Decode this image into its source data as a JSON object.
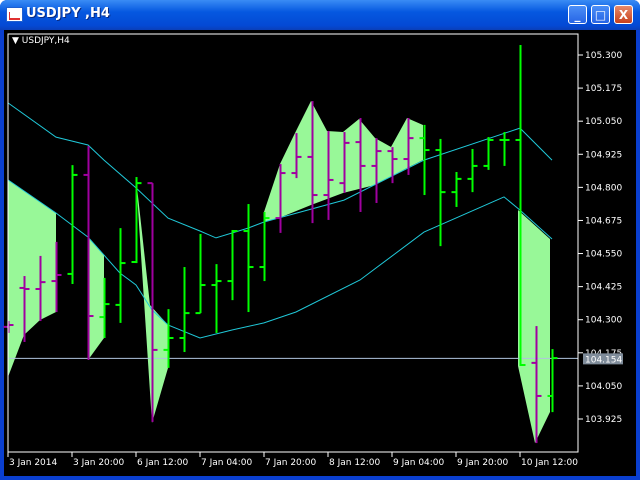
{
  "window": {
    "title": "USDJPY ,H4",
    "minimize": "_",
    "maximize": "□",
    "close": "X"
  },
  "chart_title": {
    "arrow": "▼",
    "label": "USDJPY,H4"
  },
  "colors": {
    "up": "#00ff00",
    "down": "#a000a0",
    "fill": "#98f898",
    "band": "#20c8d8",
    "price_line": "#b0c4de",
    "price_box": "#7f8c9a"
  },
  "chart_data": {
    "type": "ohlc",
    "symbol": "USDJPY",
    "timeframe": "H4",
    "ylim": [
      103.85,
      105.35
    ],
    "y_ticks": [
      "105.300",
      "105.175",
      "105.050",
      "104.925",
      "104.800",
      "104.675",
      "104.550",
      "104.425",
      "104.300",
      "104.175",
      "104.050",
      "103.925"
    ],
    "x_ticks": [
      "3 Jan 2014",
      "3 Jan 20:00",
      "6 Jan 12:00",
      "7 Jan 04:00",
      "7 Jan 20:00",
      "8 Jan 12:00",
      "9 Jan 04:00",
      "9 Jan 20:00",
      "10 Jan 12:00"
    ],
    "current_price": "104.154",
    "bars": [
      {
        "o": 104.273,
        "h": 104.295,
        "l": 104.25,
        "c": 104.28,
        "col": "down"
      },
      {
        "o": 104.42,
        "h": 104.465,
        "l": 104.216,
        "c": 104.416,
        "col": "down"
      },
      {
        "o": 104.416,
        "h": 104.541,
        "l": 104.295,
        "c": 104.442,
        "col": "down"
      },
      {
        "o": 104.446,
        "h": 104.594,
        "l": 104.329,
        "c": 104.469,
        "col": "down"
      },
      {
        "o": 104.473,
        "h": 104.884,
        "l": 104.435,
        "c": 104.847,
        "col": "up"
      },
      {
        "o": 104.847,
        "h": 104.956,
        "l": 104.148,
        "c": 104.314,
        "col": "down"
      },
      {
        "o": 104.31,
        "h": 104.458,
        "l": 104.231,
        "c": 104.359,
        "col": "up"
      },
      {
        "o": 104.356,
        "h": 104.646,
        "l": 104.288,
        "c": 104.514,
        "col": "up"
      },
      {
        "o": 104.518,
        "h": 104.839,
        "l": 104.514,
        "c": 104.816,
        "col": "up"
      },
      {
        "o": 104.816,
        "h": 104.816,
        "l": 103.914,
        "c": 104.186,
        "col": "down"
      },
      {
        "o": 104.186,
        "h": 104.34,
        "l": 104.118,
        "c": 104.231,
        "col": "up"
      },
      {
        "o": 104.231,
        "h": 104.499,
        "l": 104.178,
        "c": 104.325,
        "col": "up"
      },
      {
        "o": 104.325,
        "h": 104.624,
        "l": 104.325,
        "c": 104.431,
        "col": "up"
      },
      {
        "o": 104.431,
        "h": 104.51,
        "l": 104.25,
        "c": 104.446,
        "col": "up"
      },
      {
        "o": 104.446,
        "h": 104.639,
        "l": 104.374,
        "c": 104.635,
        "col": "up"
      },
      {
        "o": 104.635,
        "h": 104.737,
        "l": 104.329,
        "c": 104.499,
        "col": "up"
      },
      {
        "o": 104.499,
        "h": 104.707,
        "l": 104.446,
        "c": 104.684,
        "col": "up"
      },
      {
        "o": 104.684,
        "h": 104.888,
        "l": 104.628,
        "c": 104.854,
        "col": "down"
      },
      {
        "o": 104.854,
        "h": 105.005,
        "l": 104.835,
        "c": 104.915,
        "col": "down"
      },
      {
        "o": 104.915,
        "h": 105.126,
        "l": 104.665,
        "c": 104.771,
        "col": "down"
      },
      {
        "o": 104.771,
        "h": 105.013,
        "l": 104.677,
        "c": 104.828,
        "col": "down"
      },
      {
        "o": 104.816,
        "h": 105.009,
        "l": 104.779,
        "c": 104.968,
        "col": "down"
      },
      {
        "o": 104.971,
        "h": 105.062,
        "l": 104.707,
        "c": 104.881,
        "col": "down"
      },
      {
        "o": 104.881,
        "h": 104.986,
        "l": 104.741,
        "c": 104.937,
        "col": "down"
      },
      {
        "o": 104.937,
        "h": 104.952,
        "l": 104.816,
        "c": 104.907,
        "col": "down"
      },
      {
        "o": 104.907,
        "h": 105.062,
        "l": 104.847,
        "c": 104.986,
        "col": "down"
      },
      {
        "o": 104.986,
        "h": 105.036,
        "l": 104.771,
        "c": 104.941,
        "col": "up"
      },
      {
        "o": 104.941,
        "h": 104.983,
        "l": 104.578,
        "c": 104.782,
        "col": "up"
      },
      {
        "o": 104.782,
        "h": 104.858,
        "l": 104.726,
        "c": 104.832,
        "col": "up"
      },
      {
        "o": 104.832,
        "h": 104.945,
        "l": 104.782,
        "c": 104.881,
        "col": "up"
      },
      {
        "o": 104.881,
        "h": 104.99,
        "l": 104.866,
        "c": 104.979,
        "col": "up"
      },
      {
        "o": 104.979,
        "h": 105.009,
        "l": 104.881,
        "c": 104.979,
        "col": "up"
      },
      {
        "o": 104.979,
        "h": 105.338,
        "l": 104.125,
        "c": 104.129,
        "col": "up"
      },
      {
        "o": 104.137,
        "h": 104.276,
        "l": 103.834,
        "c": 104.012,
        "col": "down"
      },
      {
        "o": 104.012,
        "h": 104.189,
        "l": 103.951,
        "c": 104.155,
        "col": "up"
      }
    ],
    "upper_band": [
      [
        0,
        105.119
      ],
      [
        3,
        104.99
      ],
      [
        5,
        104.96
      ],
      [
        6,
        104.903
      ],
      [
        8,
        104.798
      ],
      [
        10,
        104.684
      ],
      [
        12,
        104.635
      ],
      [
        13,
        104.609
      ],
      [
        15,
        104.646
      ],
      [
        16,
        104.669
      ],
      [
        21,
        104.752
      ],
      [
        26,
        104.903
      ],
      [
        32,
        105.024
      ],
      [
        34,
        104.903
      ]
    ],
    "lower_band": [
      [
        0,
        104.828
      ],
      [
        3,
        104.703
      ],
      [
        5,
        104.612
      ],
      [
        7,
        104.476
      ],
      [
        8,
        104.431
      ],
      [
        9,
        104.337
      ],
      [
        10,
        104.28
      ],
      [
        12,
        104.231
      ],
      [
        14,
        104.261
      ],
      [
        16,
        104.288
      ],
      [
        18,
        104.329
      ],
      [
        22,
        104.45
      ],
      [
        26,
        104.631
      ],
      [
        31,
        104.764
      ],
      [
        32,
        104.714
      ],
      [
        34,
        104.605
      ]
    ]
  }
}
